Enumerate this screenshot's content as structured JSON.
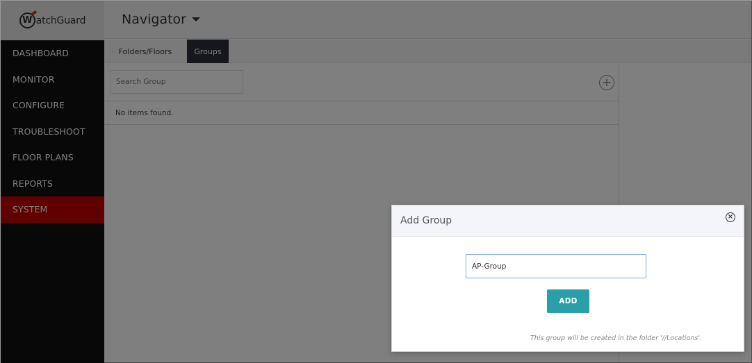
{
  "brand": {
    "logo_initial": "W",
    "logo_text": "atchGuard",
    "accent_color": "#c00000"
  },
  "sidebar": {
    "items": [
      {
        "label": "DASHBOARD",
        "active": false
      },
      {
        "label": "MONITOR",
        "active": false
      },
      {
        "label": "CONFIGURE",
        "active": false
      },
      {
        "label": "TROUBLESHOOT",
        "active": false
      },
      {
        "label": "FLOOR PLANS",
        "active": false
      },
      {
        "label": "REPORTS",
        "active": false
      },
      {
        "label": "SYSTEM",
        "active": true
      }
    ]
  },
  "header": {
    "title": "Navigator"
  },
  "tabs": [
    {
      "label": "Folders/Floors",
      "active": false
    },
    {
      "label": "Groups",
      "active": true
    }
  ],
  "search": {
    "placeholder": "Search Group"
  },
  "list": {
    "empty_text": "No items found."
  },
  "modal": {
    "title": "Add Group",
    "input_value": "AP-Group",
    "button_label": "ADD",
    "button_color": "#2a9fa8",
    "note": "This group will be created in the folder '//Locations'."
  }
}
